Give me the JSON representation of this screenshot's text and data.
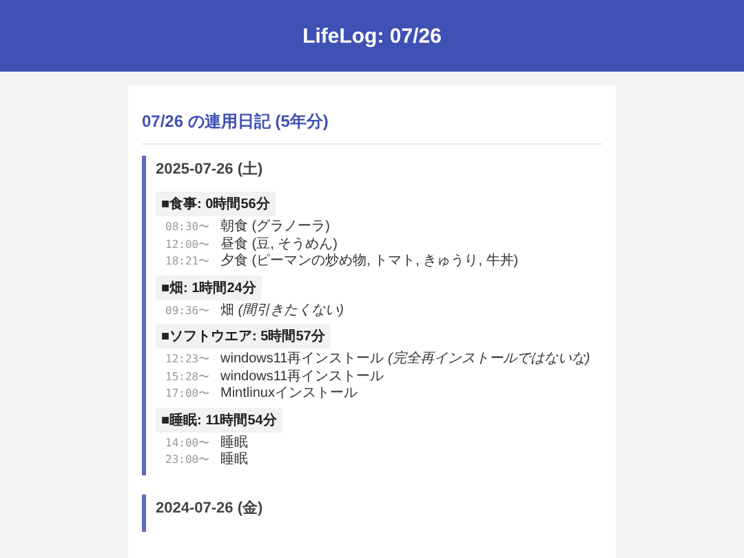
{
  "header": {
    "title": "LifeLog: 07/26"
  },
  "page_title": "07/26 の連用日記 (5年分)",
  "days": [
    {
      "date": "2025-07-26 (土)",
      "categories": [
        {
          "label": "■食事: 0時間56分",
          "entries": [
            {
              "time": "08:30〜",
              "text": "朝食 (グラノーラ)"
            },
            {
              "time": "12:00〜",
              "text": "昼食 (豆, そうめん)"
            },
            {
              "time": "18:21〜",
              "text": "夕食 (ピーマンの炒め物, トマト, きゅうり, 牛丼)"
            }
          ]
        },
        {
          "label": "■畑: 1時間24分",
          "entries": [
            {
              "time": "09:36〜",
              "text": "畑 *(間引きたくない)*"
            }
          ]
        },
        {
          "label": "■ソフトウエア: 5時間57分",
          "entries": [
            {
              "time": "12:23〜",
              "text": "windows11再インストール *(完全再インストールではないな)*"
            },
            {
              "time": "15:28〜",
              "text": "windows11再インストール"
            },
            {
              "time": "17:00〜",
              "text": "Mintlinuxインストール"
            }
          ]
        },
        {
          "label": "■睡眠: 11時間54分",
          "entries": [
            {
              "time": "14:00〜",
              "text": "睡眠"
            },
            {
              "time": "23:00〜",
              "text": "睡眠"
            }
          ]
        }
      ]
    },
    {
      "date": "2024-07-26 (金)"
    }
  ]
}
